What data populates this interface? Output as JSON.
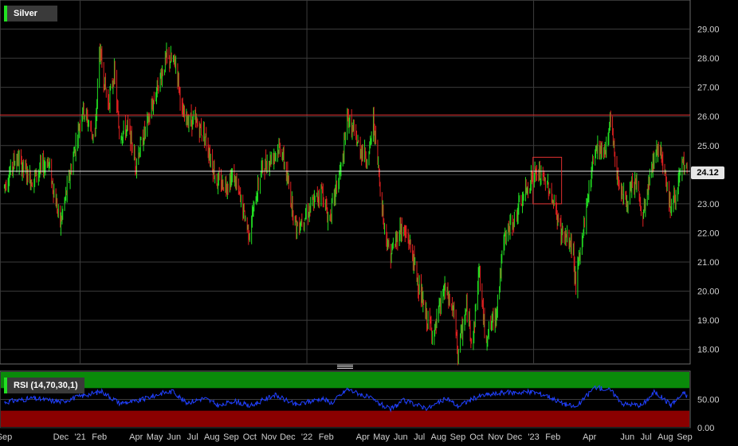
{
  "chart_data": [
    {
      "type": "candlestick",
      "legend": "Silver",
      "ylim": [
        17.5,
        30.0
      ],
      "yticks": [
        18.0,
        19.0,
        20.0,
        21.0,
        22.0,
        23.0,
        24.0,
        25.0,
        26.0,
        27.0,
        28.0,
        29.0
      ],
      "ytick_labels": [
        "18.00",
        "19.00",
        "20.00",
        "21.00",
        "22.00",
        "23.00",
        "24.00",
        "25.00",
        "26.00",
        "27.00",
        "28.00",
        "29.00"
      ],
      "last_price": 24.12,
      "last_price_label": "24.12",
      "resistance_line": 26.05,
      "trend_path": [
        [
          "2020-09-01",
          23.6
        ],
        [
          "2020-09-20",
          24.6
        ],
        [
          "2020-10-15",
          23.8
        ],
        [
          "2020-11-10",
          24.5
        ],
        [
          "2020-11-30",
          22.3
        ],
        [
          "2020-12-20",
          24.5
        ],
        [
          "2021-01-05",
          26.3
        ],
        [
          "2021-01-25",
          25.2
        ],
        [
          "2021-02-01",
          28.3
        ],
        [
          "2021-02-15",
          26.4
        ],
        [
          "2021-02-25",
          27.5
        ],
        [
          "2021-03-05",
          25.4
        ],
        [
          "2021-03-20",
          25.6
        ],
        [
          "2021-03-31",
          24.4
        ],
        [
          "2021-04-20",
          25.8
        ],
        [
          "2021-05-05",
          27.0
        ],
        [
          "2021-05-20",
          28.0
        ],
        [
          "2021-06-05",
          27.8
        ],
        [
          "2021-06-15",
          26.0
        ],
        [
          "2021-07-05",
          25.8
        ],
        [
          "2021-07-20",
          25.4
        ],
        [
          "2021-08-10",
          23.7
        ],
        [
          "2021-08-25",
          23.7
        ],
        [
          "2021-09-05",
          24.0
        ],
        [
          "2021-09-30",
          22.0
        ],
        [
          "2021-10-20",
          24.2
        ],
        [
          "2021-11-05",
          24.6
        ],
        [
          "2021-11-20",
          25.0
        ],
        [
          "2021-12-15",
          22.2
        ],
        [
          "2022-01-05",
          22.8
        ],
        [
          "2022-01-25",
          23.5
        ],
        [
          "2022-02-05",
          22.4
        ],
        [
          "2022-02-28",
          24.5
        ],
        [
          "2022-03-07",
          26.0
        ],
        [
          "2022-03-25",
          25.0
        ],
        [
          "2022-04-10",
          24.5
        ],
        [
          "2022-04-18",
          25.9
        ],
        [
          "2022-05-05",
          22.3
        ],
        [
          "2022-05-15",
          21.2
        ],
        [
          "2022-06-01",
          22.2
        ],
        [
          "2022-06-15",
          21.7
        ],
        [
          "2022-07-10",
          19.2
        ],
        [
          "2022-07-25",
          18.5
        ],
        [
          "2022-08-10",
          20.1
        ],
        [
          "2022-08-25",
          19.3
        ],
        [
          "2022-09-01",
          17.9
        ],
        [
          "2022-09-15",
          19.4
        ],
        [
          "2022-09-25",
          18.2
        ],
        [
          "2022-10-05",
          20.8
        ],
        [
          "2022-10-15",
          18.4
        ],
        [
          "2022-11-01",
          19.2
        ],
        [
          "2022-11-15",
          21.8
        ],
        [
          "2022-12-05",
          22.7
        ],
        [
          "2022-12-31",
          24.0
        ],
        [
          "2023-01-10",
          24.0
        ],
        [
          "2023-01-25",
          23.6
        ],
        [
          "2023-02-15",
          22.0
        ],
        [
          "2023-03-05",
          21.5
        ],
        [
          "2023-03-10",
          20.2
        ],
        [
          "2023-03-25",
          22.6
        ],
        [
          "2023-04-10",
          25.0
        ],
        [
          "2023-04-25",
          24.8
        ],
        [
          "2023-05-05",
          25.8
        ],
        [
          "2023-05-15",
          24.0
        ],
        [
          "2023-05-30",
          23.0
        ],
        [
          "2023-06-15",
          23.8
        ],
        [
          "2023-06-25",
          22.4
        ],
        [
          "2023-07-15",
          24.8
        ],
        [
          "2023-07-25",
          24.9
        ],
        [
          "2023-08-10",
          22.8
        ],
        [
          "2023-08-20",
          23.5
        ],
        [
          "2023-08-28",
          24.3
        ],
        [
          "2023-09-05",
          24.1
        ]
      ],
      "highlight_box": {
        "start": "2022-12-31",
        "end": "2023-02-15",
        "low": 23.0,
        "high": 24.6
      },
      "xaxis": {
        "start": "2020-08-25",
        "end": "2023-09-10",
        "ticks": [
          {
            "date": "2020-09-01",
            "label": "Sep"
          },
          {
            "date": "2020-12-01",
            "label": "Dec"
          },
          {
            "date": "2021-01-01",
            "label": "'21"
          },
          {
            "date": "2021-02-01",
            "label": "Feb"
          },
          {
            "date": "2021-04-01",
            "label": "Apr"
          },
          {
            "date": "2021-05-01",
            "label": "May"
          },
          {
            "date": "2021-06-01",
            "label": "Jun"
          },
          {
            "date": "2021-07-01",
            "label": "Jul"
          },
          {
            "date": "2021-08-01",
            "label": "Aug"
          },
          {
            "date": "2021-09-01",
            "label": "Sep"
          },
          {
            "date": "2021-10-01",
            "label": "Oct"
          },
          {
            "date": "2021-11-01",
            "label": "Nov"
          },
          {
            "date": "2021-12-01",
            "label": "Dec"
          },
          {
            "date": "2022-01-01",
            "label": "'22"
          },
          {
            "date": "2022-02-01",
            "label": "Feb"
          },
          {
            "date": "2022-04-01",
            "label": "Apr"
          },
          {
            "date": "2022-05-01",
            "label": "May"
          },
          {
            "date": "2022-06-01",
            "label": "Jun"
          },
          {
            "date": "2022-07-01",
            "label": "Jul"
          },
          {
            "date": "2022-08-01",
            "label": "Aug"
          },
          {
            "date": "2022-09-01",
            "label": "Sep"
          },
          {
            "date": "2022-10-01",
            "label": "Oct"
          },
          {
            "date": "2022-11-01",
            "label": "Nov"
          },
          {
            "date": "2022-12-01",
            "label": "Dec"
          },
          {
            "date": "2023-01-01",
            "label": "'23"
          },
          {
            "date": "2023-02-01",
            "label": "Feb"
          },
          {
            "date": "2023-04-01",
            "label": "Apr"
          },
          {
            "date": "2023-06-01",
            "label": "Jun"
          },
          {
            "date": "2023-07-01",
            "label": "Jul"
          },
          {
            "date": "2023-08-01",
            "label": "Aug"
          },
          {
            "date": "2023-09-01",
            "label": "Sep"
          }
        ],
        "gridlines": [
          "2021-01-01",
          "2022-01-01",
          "2023-01-01"
        ]
      },
      "colors": {
        "up": "#22e022",
        "down": "#e02020",
        "resistance": "#e03030",
        "last": "#e6e6e6",
        "box": "#e03030",
        "grid": "#3c3c3c"
      }
    },
    {
      "type": "line",
      "legend": "RSI (14,70,30,1)",
      "ylim": [
        0,
        100
      ],
      "yticks": [
        0,
        50
      ],
      "ytick_labels": [
        "0.00",
        "50.00"
      ],
      "overbought": 70,
      "oversold": 30,
      "rsi_path": [
        [
          "2020-09-01",
          45
        ],
        [
          "2020-10-15",
          52
        ],
        [
          "2020-12-01",
          46
        ],
        [
          "2021-01-10",
          58
        ],
        [
          "2021-02-05",
          64
        ],
        [
          "2021-03-05",
          44
        ],
        [
          "2021-04-01",
          46
        ],
        [
          "2021-05-15",
          62
        ],
        [
          "2021-06-01",
          64
        ],
        [
          "2021-06-20",
          44
        ],
        [
          "2021-07-20",
          52
        ],
        [
          "2021-08-15",
          38
        ],
        [
          "2021-09-05",
          48
        ],
        [
          "2021-10-01",
          38
        ],
        [
          "2021-11-10",
          58
        ],
        [
          "2021-12-15",
          40
        ],
        [
          "2022-01-25",
          52
        ],
        [
          "2022-02-10",
          44
        ],
        [
          "2022-03-07",
          68
        ],
        [
          "2022-04-10",
          54
        ],
        [
          "2022-05-15",
          32
        ],
        [
          "2022-06-05",
          48
        ],
        [
          "2022-07-15",
          34
        ],
        [
          "2022-08-15",
          52
        ],
        [
          "2022-09-01",
          38
        ],
        [
          "2022-10-05",
          56
        ],
        [
          "2022-11-15",
          62
        ],
        [
          "2022-12-31",
          63
        ],
        [
          "2023-01-20",
          58
        ],
        [
          "2023-02-15",
          44
        ],
        [
          "2023-03-10",
          36
        ],
        [
          "2023-04-10",
          72
        ],
        [
          "2023-05-05",
          66
        ],
        [
          "2023-05-25",
          42
        ],
        [
          "2023-06-25",
          40
        ],
        [
          "2023-07-15",
          64
        ],
        [
          "2023-08-10",
          40
        ],
        [
          "2023-09-01",
          62
        ],
        [
          "2023-09-05",
          55
        ]
      ],
      "colors": {
        "line": "#2040ff",
        "overbought_zone": "#0a8a0a",
        "oversold_zone": "#8a0000"
      }
    }
  ]
}
